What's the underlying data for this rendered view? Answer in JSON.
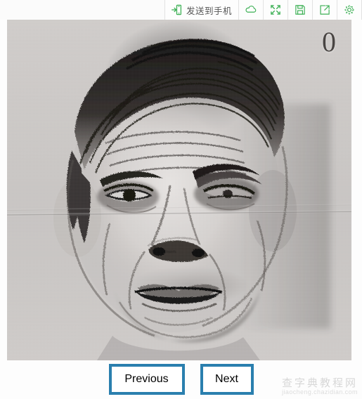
{
  "toolbar": {
    "send_to_phone": {
      "label": "发送到手机",
      "icon": "send-to-phone-icon"
    },
    "buttons": [
      {
        "name": "cloud",
        "icon": "cloud-icon",
        "title": ""
      },
      {
        "name": "fullscreen",
        "icon": "expand-arrows-icon",
        "title": ""
      },
      {
        "name": "save",
        "icon": "floppy-disk-icon",
        "title": ""
      },
      {
        "name": "share",
        "icon": "share-export-icon",
        "title": ""
      },
      {
        "name": "settings",
        "icon": "gear-icon",
        "title": ""
      }
    ],
    "accent_color": "#3cb054",
    "background_color": "#fbfbfb"
  },
  "viewer": {
    "page_number": "0",
    "image_alt": "charcoal portrait drawing of an older man's face",
    "background_color": "#c9c6c4"
  },
  "nav": {
    "previous_label": "Previous",
    "next_label": "Next",
    "border_color": "#2a7fae"
  },
  "watermark": {
    "cn": "查字典教程网",
    "en": "jiaocheng.chazidian.com"
  }
}
